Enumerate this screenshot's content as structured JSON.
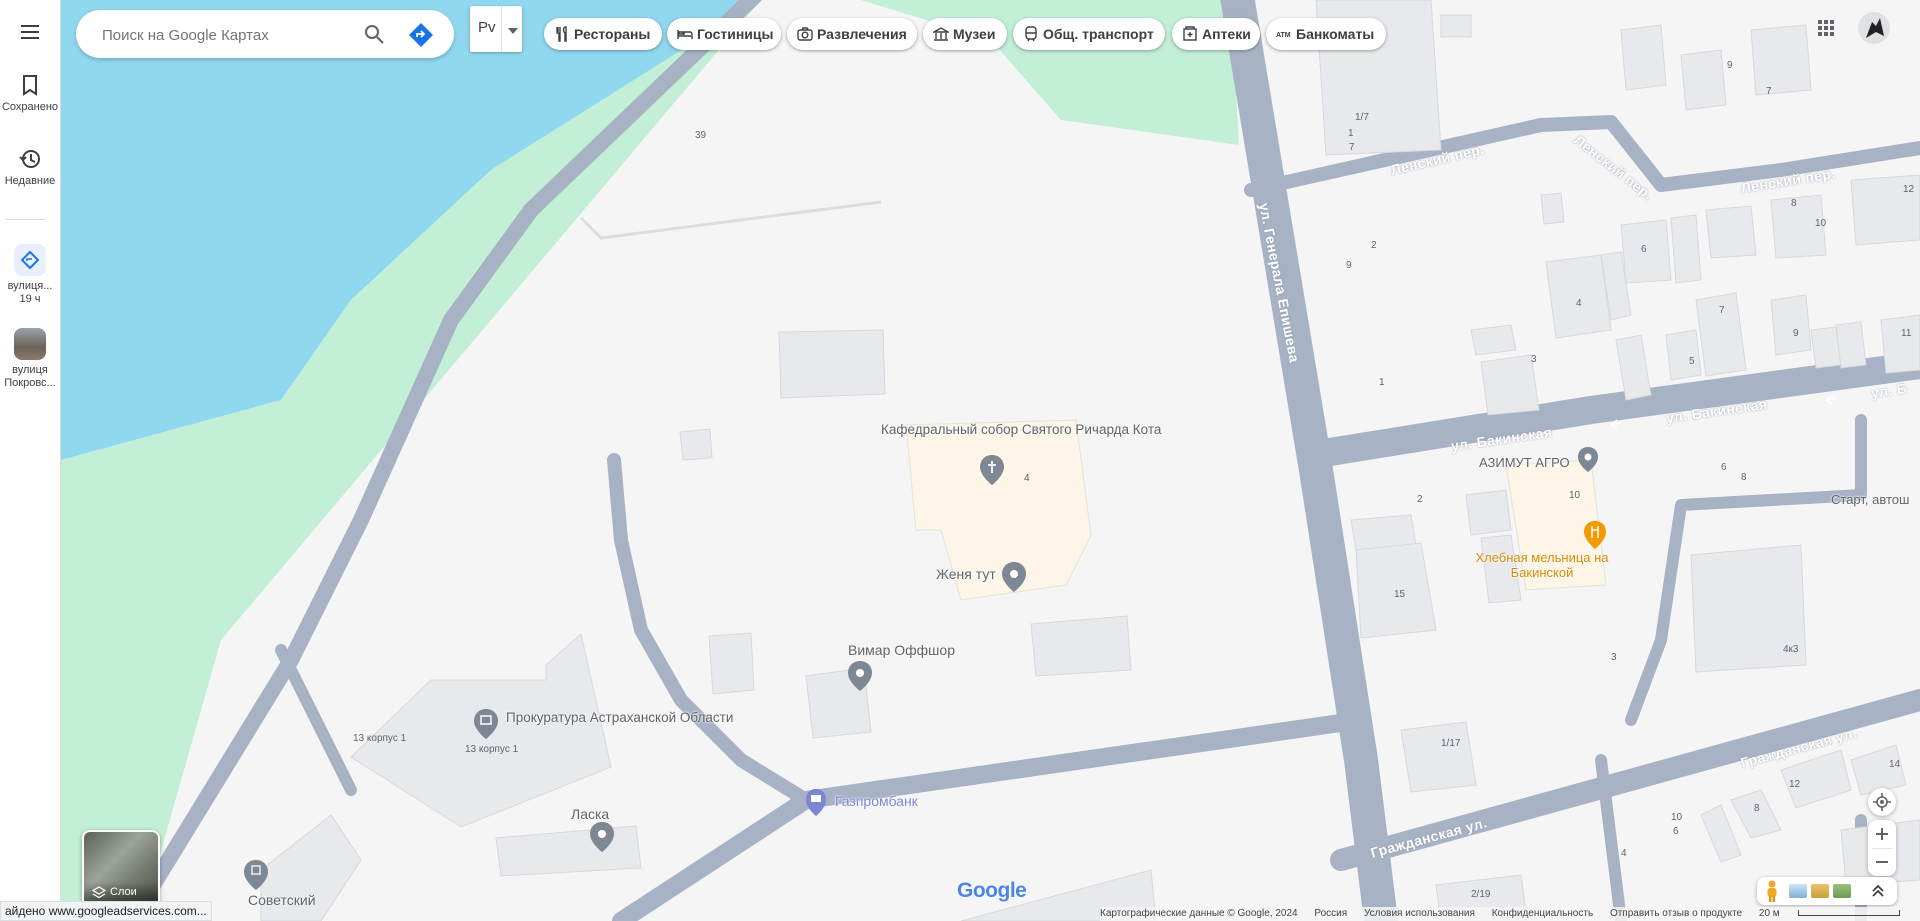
{
  "search": {
    "placeholder": "Поиск на Google Картах"
  },
  "layer_switch_label": "Рv",
  "chips": [
    {
      "label": "Рестораны",
      "icon": "fork-knife-icon"
    },
    {
      "label": "Гостиницы",
      "icon": "bed-icon"
    },
    {
      "label": "Развлечения",
      "icon": "camera-icon"
    },
    {
      "label": "Музеи",
      "icon": "museum-icon"
    },
    {
      "label": "Общ. транспорт",
      "icon": "transit-icon"
    },
    {
      "label": "Аптеки",
      "icon": "pharmacy-icon"
    },
    {
      "label": "Банкоматы",
      "icon": "atm-icon"
    }
  ],
  "rail": {
    "saved": "Сохранено",
    "recent": "Недавние",
    "history1": {
      "line1": "вулиця...",
      "line2": "19 ч"
    },
    "history2": {
      "line1": "вулиця",
      "line2": "Покровс..."
    }
  },
  "pois": {
    "cathedral": "Кафедральный собор Святого Ричарда Кота",
    "zhenya": "Женя тут",
    "vimar": "Вимар Оффшор",
    "prokuratura": "Прокуратура Астраханской Области",
    "laska": "Ласка",
    "sovetsky": "Советский",
    "gazprombank": "Газпромбанк",
    "azimut": "АЗИМУТ АГРО",
    "mill": "Хлебная мельница на Бакинской",
    "start": "Старт, автош"
  },
  "streets": {
    "lensky1": "Ленский пер.",
    "lensky2": "Ленский пер.",
    "lensky3": "Ленский пер.",
    "generala": "ул. Генерала Епишева",
    "bakinskaya1": "ул. Бакинская",
    "bakinskaya2": "ул. Бакинская",
    "bakinskaya3": "ул. Б",
    "grazhd1": "Гражданская ул.",
    "grazhd2": "Гражданская ул."
  },
  "house_numbers": {
    "h39": "39",
    "h4": "4",
    "h13k1a": "13 корпус 1",
    "h13k1b": "13 корпус 1",
    "h1_7a": "1/7",
    "h1": "1",
    "h7": "7",
    "h9": "9",
    "h7b": "7",
    "h12": "12",
    "h2": "2",
    "h9b": "9",
    "h6": "6",
    "h8": "8",
    "h10": "10",
    "h4b": "4",
    "h7c": "7",
    "h9c": "9",
    "h11": "11",
    "h3": "3",
    "h5": "5",
    "h1b": "1",
    "h6b": "6",
    "h8b": "8",
    "h2b": "2",
    "h10b": "10",
    "h15": "15",
    "h3b": "3",
    "h4k3": "4к3",
    "h1_17": "1/17",
    "h14": "14",
    "h12b": "12",
    "h8c": "8",
    "h10c": "10",
    "h6c": "6",
    "h4c": "4",
    "h2_19": "2/19"
  },
  "layers_label": "Слои",
  "google_logo": "Google",
  "footer": {
    "data": "Картографические данные © Google, 2024",
    "country": "Россия",
    "terms": "Условия использования",
    "privacy": "Конфиденциальность",
    "feedback": "Отправить отзыв о продукте",
    "scale": "20 м"
  },
  "status_url": "айдено www.googleadservices.com...",
  "colors": {
    "water": "#8fd8ef",
    "park": "#c2efd6",
    "road": "#a7b2c4",
    "land": "#f6f5f6",
    "building": "#e8e9ed",
    "poi_area": "#fcf5e8",
    "accent": "#1a73e8",
    "food": "#f29900",
    "bank": "#7b86d6"
  }
}
